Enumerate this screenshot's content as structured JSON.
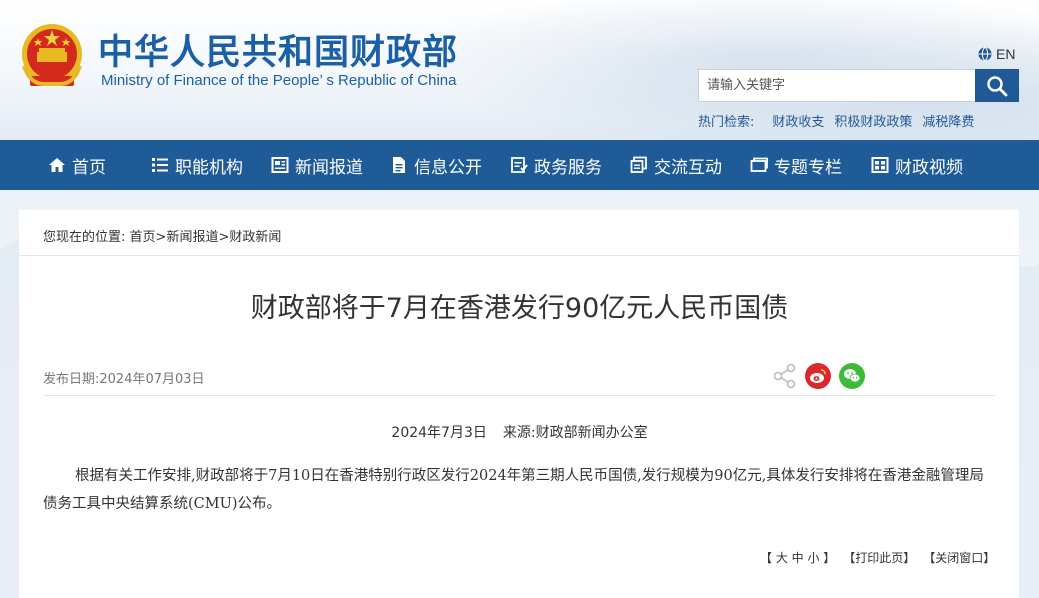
{
  "header": {
    "title": "中华人民共和国财政部",
    "subtitle": "Ministry of Finance of the People’ s Republic of China",
    "lang_label": "EN",
    "search_placeholder": "请输入关键字",
    "hot_label": "热门检索:",
    "hot_items": [
      "财政收支",
      "积极财政政策",
      "减税降费"
    ]
  },
  "nav": {
    "items": [
      {
        "label": "首页",
        "icon": "home-icon"
      },
      {
        "label": "职能机构",
        "icon": "list-icon"
      },
      {
        "label": "新闻报道",
        "icon": "newspaper-icon"
      },
      {
        "label": "信息公开",
        "icon": "document-icon"
      },
      {
        "label": "政务服务",
        "icon": "service-icon"
      },
      {
        "label": "交流互动",
        "icon": "chat-icon"
      },
      {
        "label": "专题专栏",
        "icon": "folder-icon"
      },
      {
        "label": "财政视频",
        "icon": "video-icon"
      }
    ]
  },
  "breadcrumb": {
    "prefix": "您现在的位置:",
    "items": [
      "首页",
      "新闻报道",
      "财政新闻"
    ],
    "separator": ">"
  },
  "article": {
    "title": "财政部将于7月在香港发行90亿元人民币国债",
    "publish_date": "发布日期:2024年07月03日",
    "date_line": "2024年7月3日",
    "source": "来源:财政部新闻办公室",
    "body": "根据有关工作安排,财政部将于7月10日在香港特别行政区发行2024年第三期人民币国债,发行规模为90亿元,具体发行安排将在香港金融管理局债务工具中央结算系统(CMU)公布。"
  },
  "tools": {
    "font_size": "【 大 中 小 】",
    "print": "【打印此页】",
    "close": "【关闭窗口】"
  },
  "colors": {
    "brand_blue": "#1b5fa6",
    "nav_bg": "#1f5b97",
    "weibo_red": "#d9282e",
    "wechat_green": "#3dba3a"
  }
}
